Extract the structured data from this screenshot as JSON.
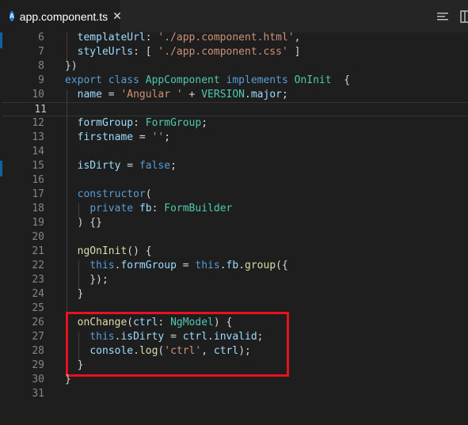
{
  "tab": {
    "icon_letter": "A",
    "filename": "app.component.ts",
    "close": "✕"
  },
  "actions": [
    "split-editor-icon",
    "toggle-minimap-icon"
  ],
  "colors": {
    "background": "#1e1e1e",
    "tabbar": "#252526",
    "angular_icon": "#1f7bd6",
    "highlight_box": "#e81123",
    "keyword": "#569cd6",
    "type": "#4ec9b0",
    "string": "#ce9178",
    "variable": "#9cdcfe",
    "function": "#dcdcaa"
  },
  "editor": {
    "current_line": 11,
    "lines": [
      {
        "n": "6",
        "tokens": [
          [
            "p",
            "  "
          ],
          [
            "v",
            "templateUrl"
          ],
          [
            "p",
            ": "
          ],
          [
            "s",
            "'./app.component.html'"
          ],
          [
            "p",
            ","
          ]
        ]
      },
      {
        "n": "7",
        "tokens": [
          [
            "p",
            "  "
          ],
          [
            "v",
            "styleUrls"
          ],
          [
            "p",
            ": [ "
          ],
          [
            "s",
            "'./app.component.css'"
          ],
          [
            "p",
            " ]"
          ]
        ]
      },
      {
        "n": "8",
        "tokens": [
          [
            "p",
            "})"
          ]
        ]
      },
      {
        "n": "9",
        "tokens": [
          [
            "k",
            "export"
          ],
          [
            "p",
            " "
          ],
          [
            "k",
            "class"
          ],
          [
            "p",
            " "
          ],
          [
            "t",
            "AppComponent"
          ],
          [
            "p",
            " "
          ],
          [
            "k",
            "implements"
          ],
          [
            "p",
            " "
          ],
          [
            "t",
            "OnInit"
          ],
          [
            "p",
            "  {"
          ]
        ]
      },
      {
        "n": "10",
        "tokens": [
          [
            "p",
            "  "
          ],
          [
            "v",
            "name"
          ],
          [
            "p",
            " = "
          ],
          [
            "s",
            "'Angular '"
          ],
          [
            "p",
            " + "
          ],
          [
            "t",
            "VERSION"
          ],
          [
            "p",
            "."
          ],
          [
            "v",
            "major"
          ],
          [
            "p",
            ";"
          ]
        ]
      },
      {
        "n": "11",
        "tokens": [
          [
            "p",
            ""
          ]
        ]
      },
      {
        "n": "12",
        "tokens": [
          [
            "p",
            "  "
          ],
          [
            "v",
            "formGroup"
          ],
          [
            "p",
            ": "
          ],
          [
            "t",
            "FormGroup"
          ],
          [
            "p",
            ";"
          ]
        ]
      },
      {
        "n": "13",
        "tokens": [
          [
            "p",
            "  "
          ],
          [
            "v",
            "firstname"
          ],
          [
            "p",
            " = "
          ],
          [
            "s",
            "''"
          ],
          [
            "p",
            ";"
          ]
        ]
      },
      {
        "n": "14",
        "tokens": [
          [
            "p",
            ""
          ]
        ]
      },
      {
        "n": "15",
        "tokens": [
          [
            "p",
            "  "
          ],
          [
            "v",
            "isDirty"
          ],
          [
            "p",
            " = "
          ],
          [
            "k",
            "false"
          ],
          [
            "p",
            ";"
          ]
        ]
      },
      {
        "n": "16",
        "tokens": [
          [
            "p",
            ""
          ]
        ]
      },
      {
        "n": "17",
        "tokens": [
          [
            "p",
            "  "
          ],
          [
            "k",
            "constructor"
          ],
          [
            "p",
            "("
          ]
        ]
      },
      {
        "n": "18",
        "tokens": [
          [
            "p",
            "    "
          ],
          [
            "k",
            "private"
          ],
          [
            "p",
            " "
          ],
          [
            "v",
            "fb"
          ],
          [
            "p",
            ": "
          ],
          [
            "t",
            "FormBuilder"
          ]
        ]
      },
      {
        "n": "19",
        "tokens": [
          [
            "p",
            "  ) {}"
          ]
        ]
      },
      {
        "n": "20",
        "tokens": [
          [
            "p",
            ""
          ]
        ]
      },
      {
        "n": "21",
        "tokens": [
          [
            "p",
            "  "
          ],
          [
            "f",
            "ngOnInit"
          ],
          [
            "p",
            "() {"
          ]
        ]
      },
      {
        "n": "22",
        "tokens": [
          [
            "p",
            "    "
          ],
          [
            "k",
            "this"
          ],
          [
            "p",
            "."
          ],
          [
            "v",
            "formGroup"
          ],
          [
            "p",
            " = "
          ],
          [
            "k",
            "this"
          ],
          [
            "p",
            "."
          ],
          [
            "v",
            "fb"
          ],
          [
            "p",
            "."
          ],
          [
            "f",
            "group"
          ],
          [
            "p",
            "({"
          ]
        ]
      },
      {
        "n": "23",
        "tokens": [
          [
            "p",
            "    });"
          ]
        ]
      },
      {
        "n": "24",
        "tokens": [
          [
            "p",
            "  }"
          ]
        ]
      },
      {
        "n": "25",
        "tokens": [
          [
            "p",
            ""
          ]
        ]
      },
      {
        "n": "26",
        "tokens": [
          [
            "p",
            "  "
          ],
          [
            "f",
            "onChange"
          ],
          [
            "p",
            "("
          ],
          [
            "v",
            "ctrl"
          ],
          [
            "p",
            ": "
          ],
          [
            "t",
            "NgModel"
          ],
          [
            "p",
            ") {"
          ]
        ]
      },
      {
        "n": "27",
        "tokens": [
          [
            "p",
            "    "
          ],
          [
            "k",
            "this"
          ],
          [
            "p",
            "."
          ],
          [
            "v",
            "isDirty"
          ],
          [
            "p",
            " = "
          ],
          [
            "v",
            "ctrl"
          ],
          [
            "p",
            "."
          ],
          [
            "v",
            "invalid"
          ],
          [
            "p",
            ";"
          ]
        ]
      },
      {
        "n": "28",
        "tokens": [
          [
            "p",
            "    "
          ],
          [
            "v",
            "console"
          ],
          [
            "p",
            "."
          ],
          [
            "f",
            "log"
          ],
          [
            "p",
            "("
          ],
          [
            "s",
            "'ctrl'"
          ],
          [
            "p",
            ", "
          ],
          [
            "v",
            "ctrl"
          ],
          [
            "p",
            ");"
          ]
        ]
      },
      {
        "n": "29",
        "tokens": [
          [
            "p",
            "  }"
          ]
        ]
      },
      {
        "n": "30",
        "tokens": [
          [
            "p",
            "}"
          ]
        ]
      },
      {
        "n": "31",
        "tokens": [
          [
            "p",
            ""
          ]
        ]
      }
    ]
  }
}
